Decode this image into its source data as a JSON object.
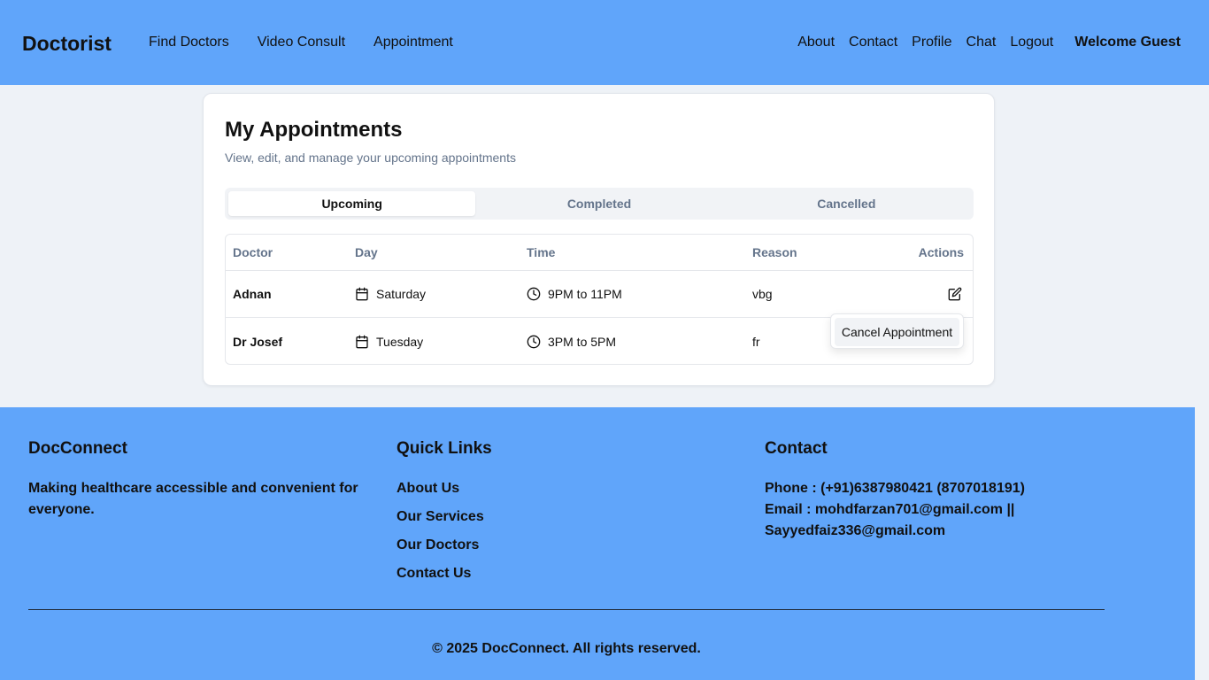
{
  "header": {
    "logo": "Doctorist",
    "nav_left": [
      "Find Doctors",
      "Video Consult",
      "Appointment"
    ],
    "nav_right": [
      "About",
      "Contact",
      "Profile",
      "Chat",
      "Logout"
    ],
    "welcome": "Welcome Guest"
  },
  "card": {
    "title": "My Appointments",
    "subtitle": "View, edit, and manage your upcoming appointments",
    "tabs": [
      "Upcoming",
      "Completed",
      "Cancelled"
    ],
    "active_tab": "Upcoming",
    "columns": [
      "Doctor",
      "Day",
      "Time",
      "Reason",
      "Actions"
    ],
    "rows": [
      {
        "doctor": "Adnan",
        "day": "Saturday",
        "time": "9PM to 11PM",
        "reason": "vbg"
      },
      {
        "doctor": "Dr Josef",
        "day": "Tuesday",
        "time": "3PM to 5PM",
        "reason": "fr"
      }
    ],
    "dropdown_item": "Cancel Appointment"
  },
  "footer": {
    "col1": {
      "heading": "DocConnect",
      "text": "Making healthcare accessible and convenient for everyone."
    },
    "col2": {
      "heading": "Quick Links",
      "links": [
        "About Us",
        "Our Services",
        "Our Doctors",
        "Contact Us"
      ]
    },
    "col3": {
      "heading": "Contact",
      "phone": "Phone : (+91)6387980421 (8707018191)",
      "email_line1": "Email : mohdfarzan701@gmail.com ||",
      "email_line2": "Sayyedfaiz336@gmail.com"
    },
    "copyright": "© 2025 DocConnect. All rights reserved."
  },
  "colors": {
    "header_bg": "#60a5fa",
    "footer_bg": "#60a5fa",
    "page_bg": "#eef2f7"
  }
}
